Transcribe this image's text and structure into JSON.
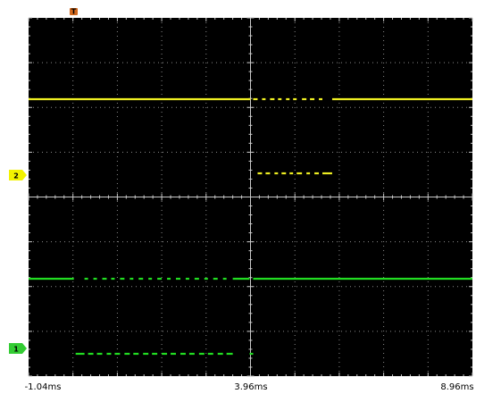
{
  "colors": {
    "background": "#000000",
    "grid": "#8a8a8a",
    "axis": "#c8c8c8",
    "channel_1": "#22dd22",
    "channel_2": "#eeee22",
    "trigger_marker": "#d2691e",
    "channel_1_marker": "#33cc33",
    "channel_2_marker": "#f2f200"
  },
  "chart_data": {
    "type": "line",
    "title": "",
    "xlabel": "",
    "ylabel": "",
    "x_unit": "ms",
    "xlim": [
      -1.04,
      8.96
    ],
    "x_ticks": [
      "-1.04ms",
      "3.96ms",
      "8.96ms"
    ],
    "grid": true,
    "legend": "none",
    "trigger_marker_label": "T",
    "series": [
      {
        "marker_label": "2",
        "color": "#eeee22",
        "high_segments": [
          [
            -1.04,
            3.96
          ],
          [
            4.02,
            4.12
          ],
          [
            4.22,
            4.3
          ],
          [
            4.4,
            4.5
          ],
          [
            4.58,
            4.66
          ],
          [
            4.76,
            4.84
          ],
          [
            4.92,
            5.0
          ],
          [
            5.12,
            5.22
          ],
          [
            5.3,
            5.4
          ],
          [
            5.5,
            5.58
          ],
          [
            5.8,
            8.96
          ]
        ],
        "low_segments": [
          [
            4.12,
            4.22
          ],
          [
            4.3,
            4.4
          ],
          [
            4.5,
            4.58
          ],
          [
            4.66,
            4.76
          ],
          [
            4.84,
            4.92
          ],
          [
            5.0,
            5.12
          ],
          [
            5.22,
            5.3
          ],
          [
            5.4,
            5.5
          ],
          [
            5.58,
            5.8
          ]
        ]
      },
      {
        "marker_label": "1",
        "color": "#22dd22",
        "high_segments": [
          [
            -1.04,
            -0.02
          ],
          [
            0.22,
            0.3
          ],
          [
            0.42,
            0.5
          ],
          [
            0.62,
            0.72
          ],
          [
            0.82,
            0.9
          ],
          [
            1.02,
            1.12
          ],
          [
            1.24,
            1.32
          ],
          [
            1.44,
            1.54
          ],
          [
            1.66,
            1.74
          ],
          [
            1.86,
            1.96
          ],
          [
            2.08,
            2.16
          ],
          [
            2.28,
            2.38
          ],
          [
            2.5,
            2.58
          ],
          [
            2.7,
            2.8
          ],
          [
            2.92,
            3.0
          ],
          [
            3.12,
            3.22
          ],
          [
            3.34,
            3.42
          ],
          [
            3.56,
            3.94
          ],
          [
            4.02,
            8.96
          ]
        ],
        "low_segments": [
          [
            0.02,
            0.22
          ],
          [
            0.3,
            0.42
          ],
          [
            0.5,
            0.62
          ],
          [
            0.72,
            0.82
          ],
          [
            0.9,
            1.02
          ],
          [
            1.12,
            1.24
          ],
          [
            1.32,
            1.44
          ],
          [
            1.54,
            1.66
          ],
          [
            1.74,
            1.86
          ],
          [
            1.96,
            2.08
          ],
          [
            2.16,
            2.28
          ],
          [
            2.38,
            2.5
          ],
          [
            2.58,
            2.7
          ],
          [
            2.8,
            2.92
          ],
          [
            3.0,
            3.12
          ],
          [
            3.22,
            3.34
          ],
          [
            3.42,
            3.56
          ],
          [
            3.94,
            4.02
          ]
        ]
      }
    ]
  }
}
